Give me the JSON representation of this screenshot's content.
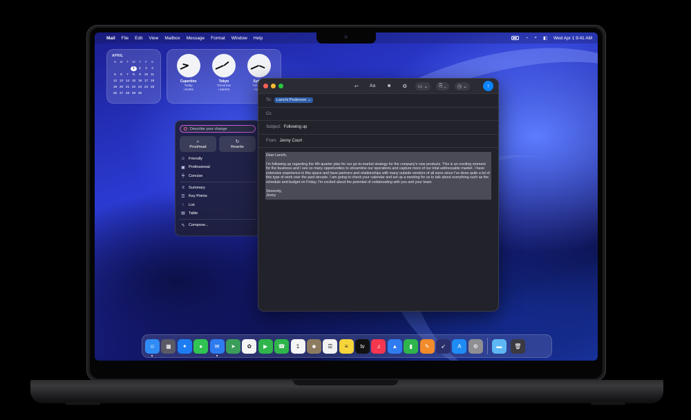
{
  "menubar": {
    "app": "Mail",
    "items": [
      "File",
      "Edit",
      "View",
      "Mailbox",
      "Message",
      "Format",
      "Window",
      "Help"
    ],
    "datetime": "Wed Apr 1  9:41 AM"
  },
  "calendar": {
    "month": "APRIL",
    "weekdays": [
      "S",
      "M",
      "T",
      "W",
      "T",
      "F",
      "S"
    ],
    "rows": [
      [
        "",
        "",
        "",
        "1",
        "2",
        "3",
        "4"
      ],
      [
        "5",
        "6",
        "7",
        "8",
        "9",
        "10",
        "11"
      ],
      [
        "12",
        "13",
        "14",
        "15",
        "16",
        "17",
        "18"
      ],
      [
        "19",
        "20",
        "21",
        "22",
        "23",
        "24",
        "25"
      ],
      [
        "26",
        "27",
        "28",
        "29",
        "30",
        "",
        ""
      ]
    ],
    "today": "1"
  },
  "clocks": [
    {
      "city": "Cupertino",
      "day": "Today",
      "offset": "+0HRS"
    },
    {
      "city": "Tokyo",
      "day": "Tomorrow",
      "offset": "+16HRS"
    },
    {
      "city": "Sydney",
      "day": "Tomorrow",
      "offset": "+18HRS"
    }
  ],
  "writing_tools": {
    "input_placeholder": "Describe your change",
    "proofread": "Proofread",
    "rewrite": "Rewrite",
    "friendly": "Friendly",
    "professional": "Professional",
    "concise": "Concise",
    "summary": "Summary",
    "key_points": "Key Points",
    "list": "List",
    "table": "Table",
    "compose": "Compose..."
  },
  "mail": {
    "to_label": "To:",
    "to_recipient": "Lanchi Pederson",
    "cc_label": "Cc:",
    "subject_label": "Subject:",
    "subject": "Following up",
    "from_label": "From:",
    "from": "Jenny Court",
    "greeting": "Dear Lanchi,",
    "paragraph": "I'm following up regarding the 4th quarter plan for our go-to-market strategy for the company's new products. This is an exciting moment for the business and I see so many opportunities to streamline our operations and capture more of our total addressable market. I have extensive experience in this space and have partners and relationships with many outside vendors of all sizes since I've done quite a lot of this type of work over the past decade. I am going to check your calendar and set up a meeting for us to talk about everything such as the schedule and budget on Friday. I'm excited about the potential of collaborating with you and your team.",
    "closing": "Sincerely,",
    "signature": "Jenny"
  },
  "dock": {
    "apps": [
      {
        "name": "finder",
        "color": "#2f8cf5",
        "glyph": "☺",
        "running": true
      },
      {
        "name": "launchpad",
        "color": "#5a5a66",
        "glyph": "▦",
        "running": false
      },
      {
        "name": "safari",
        "color": "#1d7cf2",
        "glyph": "✦",
        "running": false
      },
      {
        "name": "messages",
        "color": "#31c452",
        "glyph": "●",
        "running": false
      },
      {
        "name": "mail",
        "color": "#2e7bf0",
        "glyph": "✉",
        "running": true
      },
      {
        "name": "maps",
        "color": "#3a9d5a",
        "glyph": "➤",
        "running": false
      },
      {
        "name": "photos",
        "color": "#f4f4f4",
        "glyph": "✿",
        "running": false
      },
      {
        "name": "facetime",
        "color": "#2fb54b",
        "glyph": "▶",
        "running": false
      },
      {
        "name": "phone",
        "color": "#2fb54b",
        "glyph": "☎",
        "running": false
      },
      {
        "name": "calendar",
        "color": "#f5f5f5",
        "glyph": "1",
        "running": false
      },
      {
        "name": "contacts",
        "color": "#8c7b5e",
        "glyph": "☻",
        "running": false
      },
      {
        "name": "reminders",
        "color": "#f2f2f2",
        "glyph": "☰",
        "running": false
      },
      {
        "name": "notes",
        "color": "#f7d43a",
        "glyph": "≡",
        "running": false
      },
      {
        "name": "tv",
        "color": "#111111",
        "glyph": "tv",
        "running": false
      },
      {
        "name": "music",
        "color": "#f5364f",
        "glyph": "♫",
        "running": false
      },
      {
        "name": "keynote",
        "color": "#2f7bf0",
        "glyph": "▲",
        "running": false
      },
      {
        "name": "numbers",
        "color": "#2fb54b",
        "glyph": "▮",
        "running": false
      },
      {
        "name": "pages",
        "color": "#f28b2a",
        "glyph": "✎",
        "running": false
      },
      {
        "name": "instruments",
        "color": "#2a2f6b",
        "glyph": "➶",
        "running": false
      },
      {
        "name": "app-store",
        "color": "#1f8cf5",
        "glyph": "A",
        "running": false
      },
      {
        "name": "system-settings",
        "color": "#8e8e93",
        "glyph": "⚙",
        "running": false
      }
    ],
    "folder": {
      "name": "downloads-folder",
      "color": "#5db7f5",
      "glyph": "▬"
    },
    "trash": {
      "name": "trash",
      "color": "#3a3a40",
      "glyph": "🗑"
    }
  }
}
